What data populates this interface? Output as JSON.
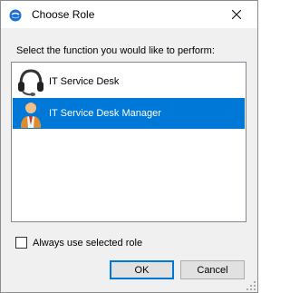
{
  "window": {
    "title": "Choose Role",
    "close_icon": "close-icon",
    "app_icon": "app-globe-icon"
  },
  "prompt": "Select the function you would like to perform:",
  "roles": [
    {
      "label": "IT Service Desk",
      "icon": "headset-icon",
      "selected": false
    },
    {
      "label": "IT Service Desk Manager",
      "icon": "manager-person-icon",
      "selected": true
    }
  ],
  "always_use": {
    "label": "Always use selected role",
    "checked": false
  },
  "buttons": {
    "ok_label": "OK",
    "cancel_label": "Cancel"
  },
  "colors": {
    "selection": "#0078d7",
    "dialog_bg": "#f0f0f0"
  }
}
